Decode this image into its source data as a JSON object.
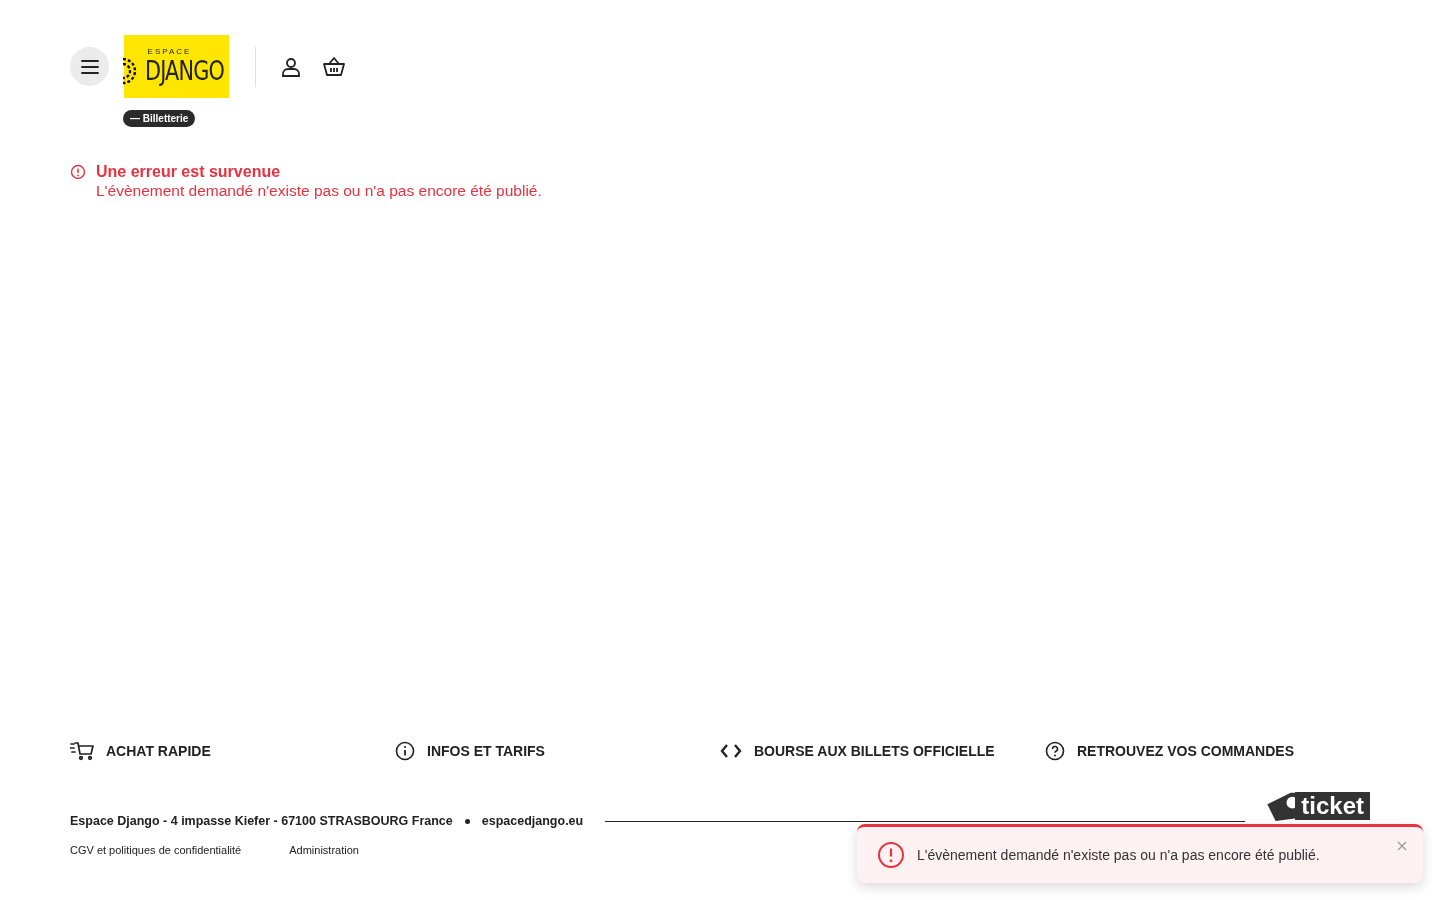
{
  "header": {
    "logo": {
      "top": "ESPACE",
      "main": "DJANGO"
    },
    "badge": "— Billetterie"
  },
  "error": {
    "title": "Une erreur est survenue",
    "message": "L'évènement demandé n'existe pas ou n'a pas encore été publié."
  },
  "footer": {
    "links": [
      {
        "kind": "cart",
        "label": "ACHAT RAPIDE"
      },
      {
        "kind": "info",
        "label": "INFOS ET TARIFS"
      },
      {
        "kind": "exchange",
        "label": "BOURSE AUX BILLETS OFFICIELLE"
      },
      {
        "kind": "help",
        "label": "RETROUVEZ VOS COMMANDES"
      }
    ],
    "address": "Espace Django - 4 impasse Kiefer - 67100 STRASBOURG France",
    "website": "espacedjango.eu",
    "partner_logo": "ticket",
    "legal_links": [
      "CGV et politiques de confidentialité",
      "Administration"
    ]
  },
  "toast": {
    "message": "L'évènement demandé n'existe pas ou n'a pas encore été publié."
  }
}
